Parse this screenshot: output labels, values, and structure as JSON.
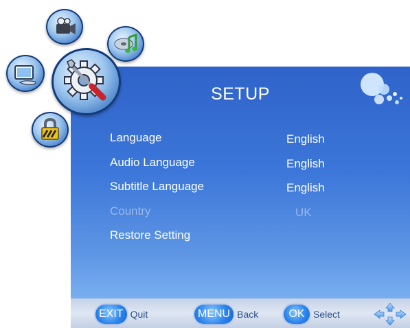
{
  "osd": {
    "title": "SETUP",
    "menu_items": [
      {
        "label": "Language",
        "value": "English",
        "enabled": true
      },
      {
        "label": "Audio Language",
        "value": "English",
        "enabled": true
      },
      {
        "label": "Subtitle Language",
        "value": "English",
        "enabled": true
      },
      {
        "label": "Country",
        "value": "UK",
        "enabled": false
      },
      {
        "label": "Restore Setting",
        "value": "",
        "enabled": true
      }
    ]
  },
  "hints": {
    "exit_key": "EXIT",
    "exit_action": "Quit",
    "menu_key": "MENU",
    "menu_action": "Back",
    "ok_key": "OK",
    "ok_action": "Select"
  },
  "menu_icons": [
    "camcorder-icon",
    "music-disc-icon",
    "pc-monitor-icon",
    "settings-gear-wrench-icon",
    "lock-icon"
  ],
  "colors": {
    "panel_top": "#2f63c9",
    "panel_bottom": "#79aef0",
    "text": "#ffffff",
    "disabled_text": "#9ab8ea",
    "key_blue": "#2d86ee"
  }
}
